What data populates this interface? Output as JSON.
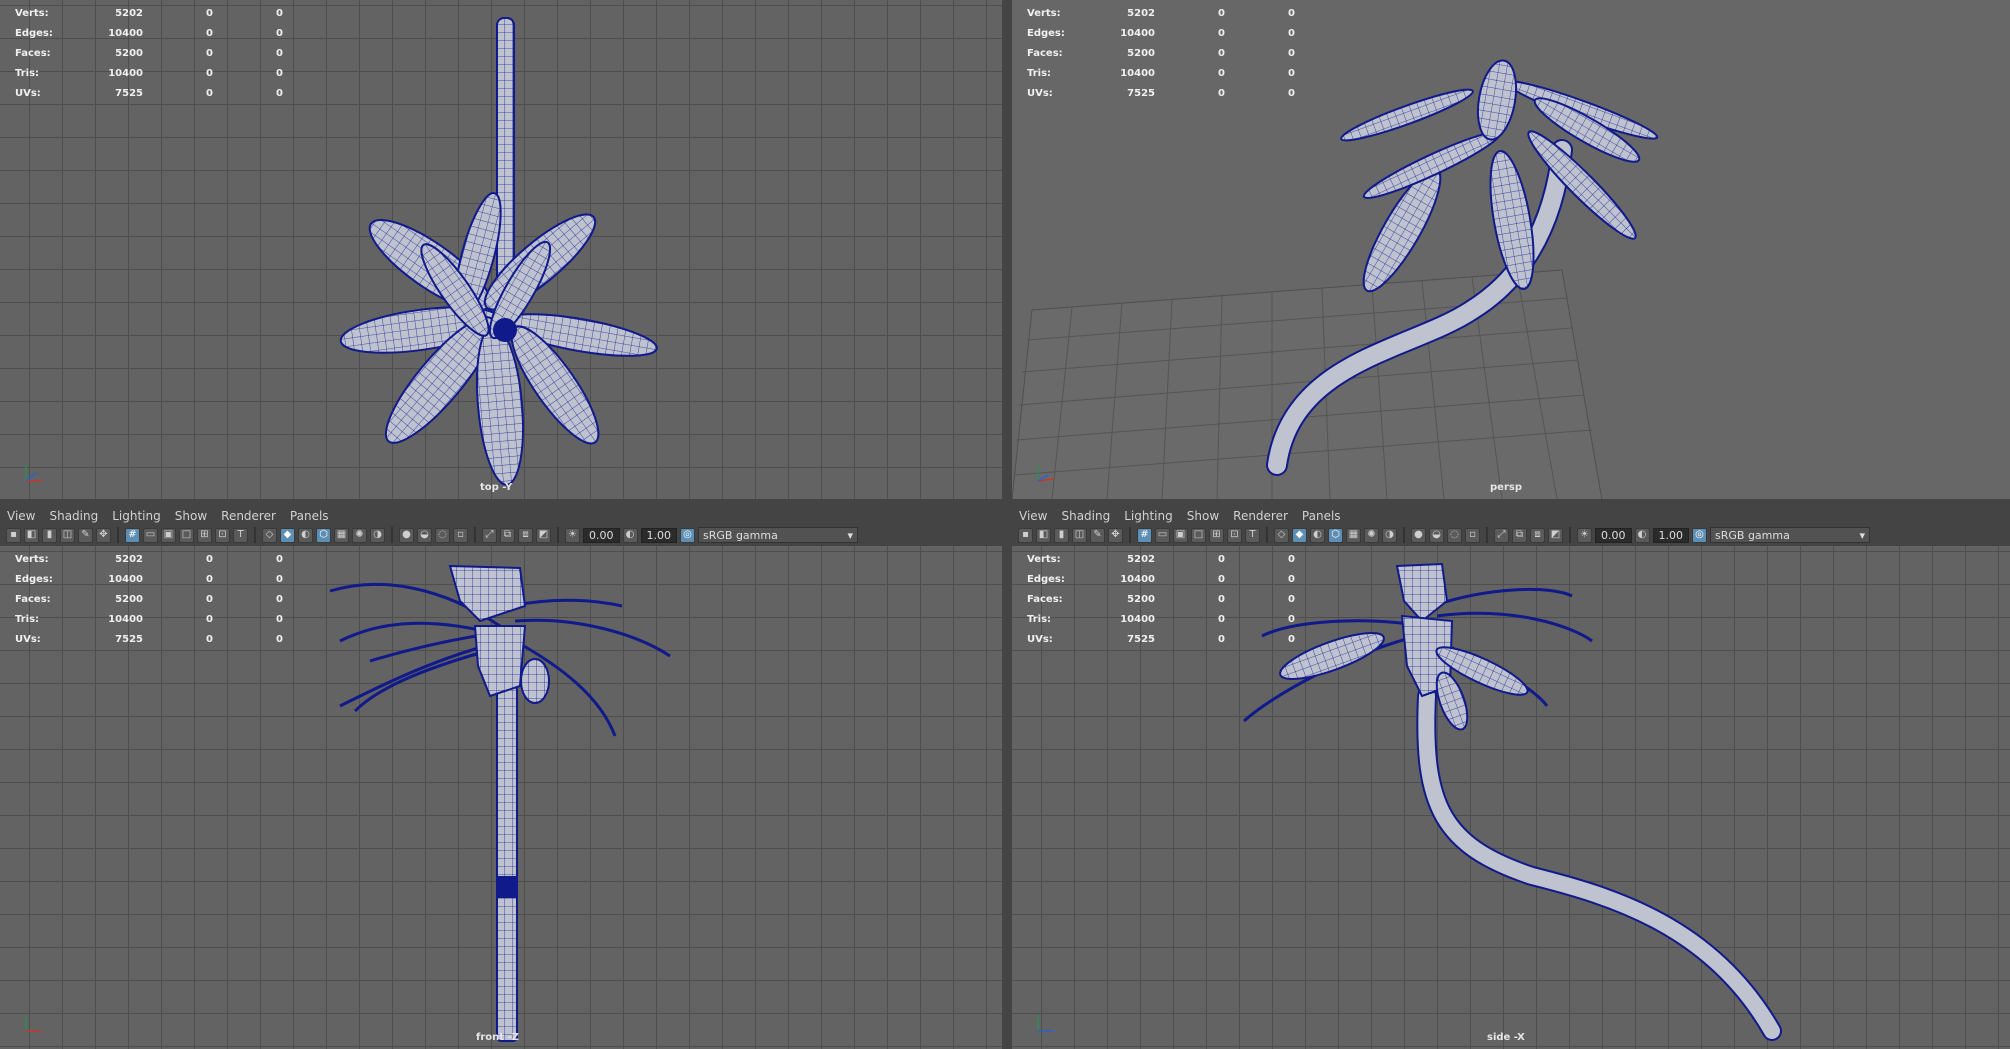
{
  "stats": {
    "rows": [
      {
        "label": "Verts:",
        "v1": "5202",
        "v2": "0",
        "v3": "0"
      },
      {
        "label": "Edges:",
        "v1": "10400",
        "v2": "0",
        "v3": "0"
      },
      {
        "label": "Faces:",
        "v1": "5200",
        "v2": "0",
        "v3": "0"
      },
      {
        "label": "Tris:",
        "v1": "10400",
        "v2": "0",
        "v3": "0"
      },
      {
        "label": "UVs:",
        "v1": "7525",
        "v2": "0",
        "v3": "0"
      }
    ]
  },
  "viewports": {
    "top": {
      "camera": "top -Y"
    },
    "persp": {
      "camera": "persp"
    },
    "front": {
      "camera": "front -Z"
    },
    "side": {
      "camera": "side -X"
    }
  },
  "panel_menu": [
    "View",
    "Shading",
    "Lighting",
    "Show",
    "Renderer",
    "Panels"
  ],
  "panel_toolbar": {
    "exposure": "0.00",
    "gamma": "1.00",
    "color_space": "sRGB gamma"
  },
  "colors": {
    "viewport_bg": "#636363",
    "grid": "#4e4e4e",
    "wireframe": "#101a8a",
    "mesh_fill": "#b9bcc9"
  },
  "icons": {
    "dropdown": "chevron-down-icon",
    "axis": "axis-gizmo-icon"
  }
}
